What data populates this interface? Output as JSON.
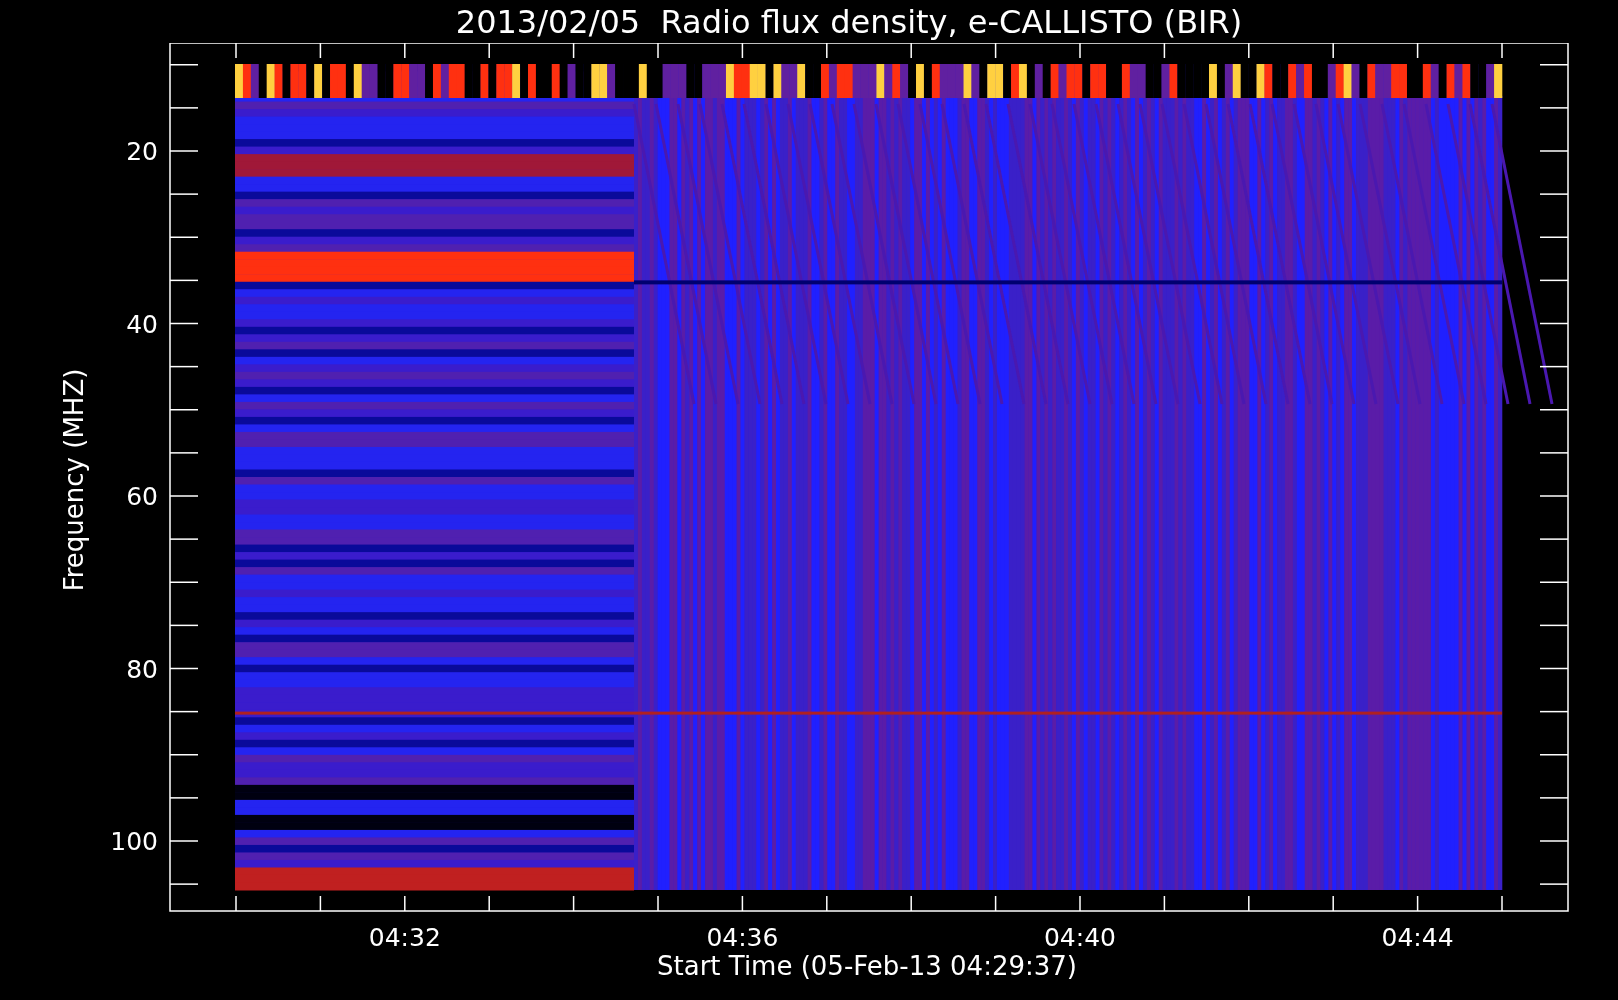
{
  "title": "2013/02/05  Radio flux density, e-CALLISTO (BIR)",
  "plot": {
    "xlabel": "Start Time (05-Feb-13 04:29:37)",
    "ylabel": "Frequency (MHZ)",
    "xtick_labels": [
      "04:32",
      "04:36",
      "04:40",
      "04:44"
    ],
    "ytick_labels": [
      "20",
      "40",
      "60",
      "80",
      "100"
    ]
  }
}
